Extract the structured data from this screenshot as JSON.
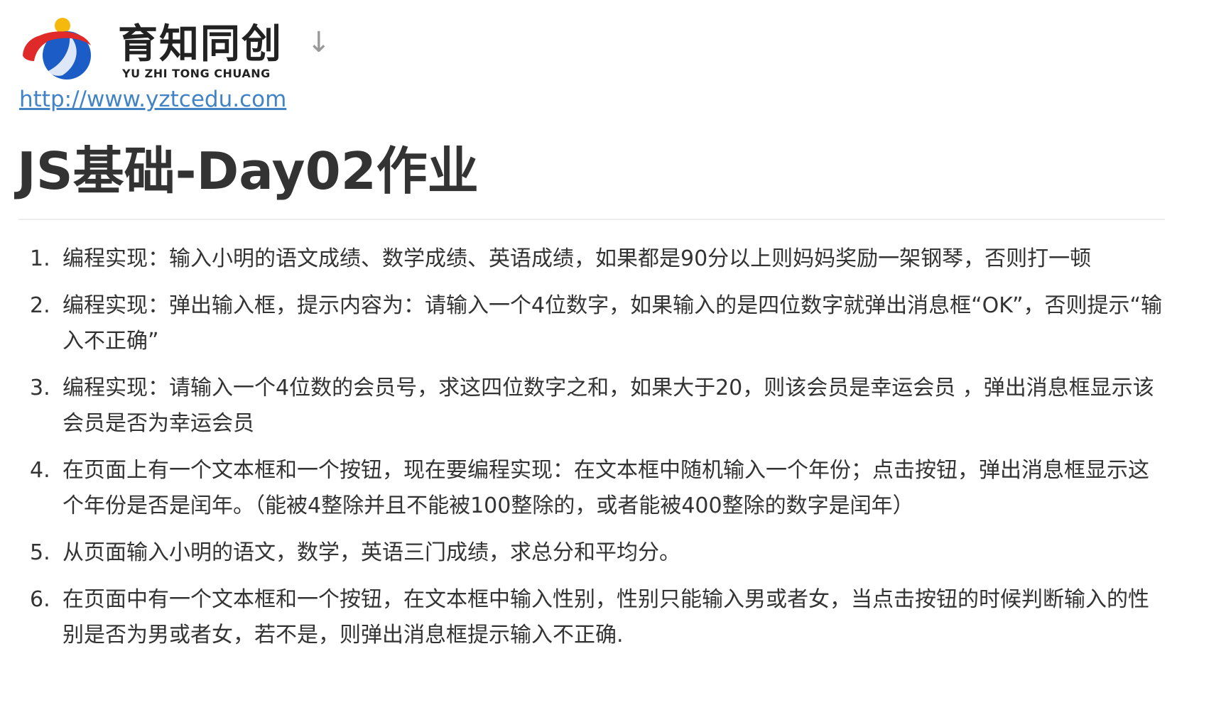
{
  "logo": {
    "name_cn": "育知同创",
    "name_en": "YU ZHI TONG CHUANG",
    "arrow": "↓",
    "colors": {
      "red": "#e02a2a",
      "blue": "#1c5cc6",
      "yellow": "#f5b90e"
    }
  },
  "link": {
    "text": "http://www.yztcedu.com"
  },
  "title": "JS基础-Day02作业",
  "tasks": [
    {
      "num": "1.",
      "text": "编程实现：输入小明的语文成绩、数学成绩、英语成绩，如果都是90分以上则妈妈奖励一架钢琴，否则打一顿"
    },
    {
      "num": "2.",
      "text": "编程实现：弹出输入框，提示内容为：请输入一个4位数字，如果输入的是四位数字就弹出消息框“OK”，否则提示“输入不正确”"
    },
    {
      "num": "3.",
      "text": "编程实现：请输入一个4位数的会员号，求这四位数字之和，如果大于20，则该会员是幸运会员 ，弹出消息框显示该会员是否为幸运会员"
    },
    {
      "num": "4.",
      "text": "在页面上有一个文本框和一个按钮，现在要编程实现：在文本框中随机输入一个年份；点击按钮，弹出消息框显示这个年份是否是闰年。（能被4整除并且不能被100整除的，或者能被400整除的数字是闰年）"
    },
    {
      "num": "5.",
      "text": "从页面输入小明的语文，数学，英语三门成绩，求总分和平均分。"
    },
    {
      "num": "6.",
      "text": "在页面中有一个文本框和一个按钮，在文本框中输入性别，性别只能输入男或者女，当点击按钮的时候判断输入的性别是否为男或者女，若不是，则弹出消息框提示输入不正确."
    }
  ]
}
